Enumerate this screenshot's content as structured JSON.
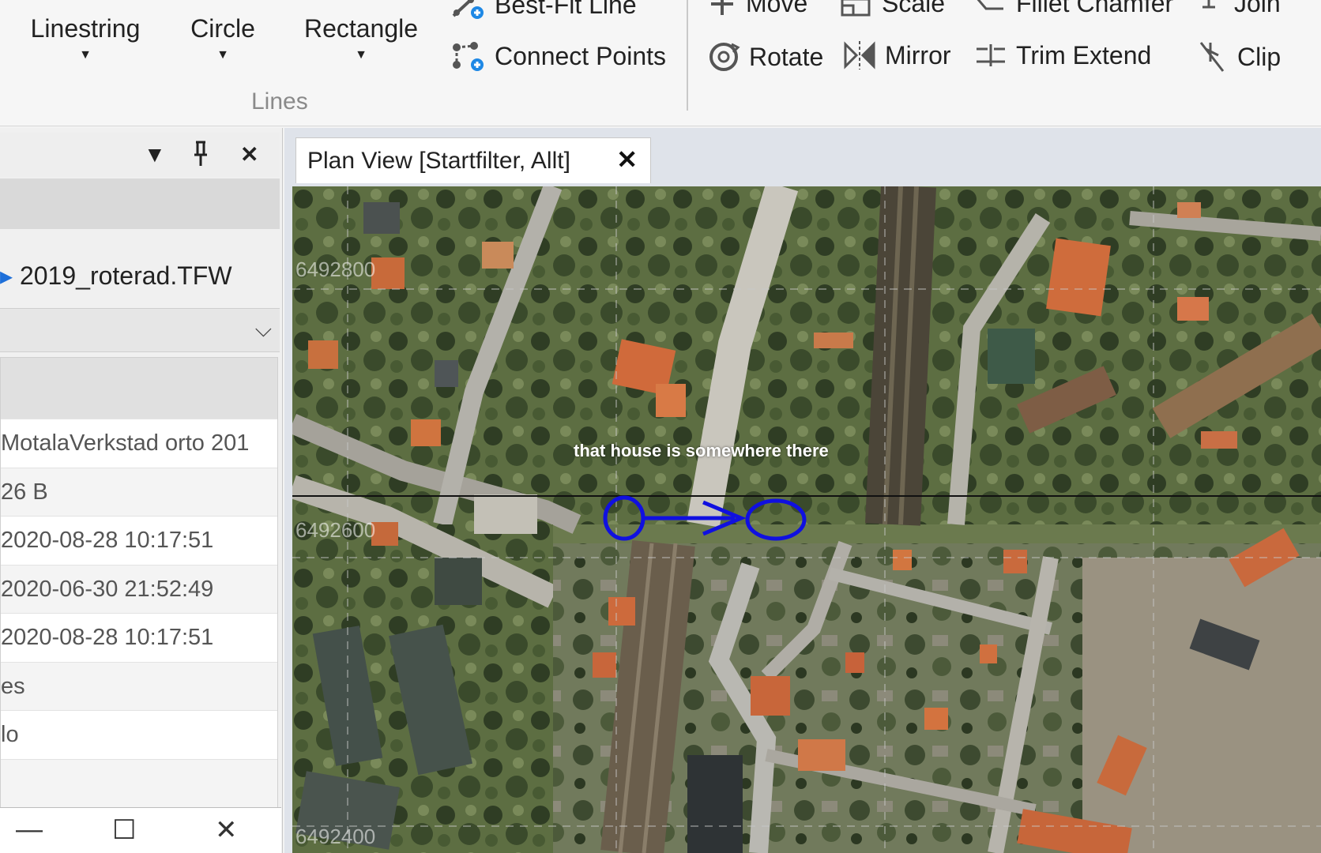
{
  "ribbon": {
    "linestring": "Linestring",
    "circle": "Circle",
    "rectangle": "Rectangle",
    "best_fit_line": "Best-Fit Line",
    "connect_points": "Connect Points",
    "lines_group": "Lines",
    "move": "Move",
    "scale": "Scale",
    "fillet_chamfer": "Fillet Chamfer",
    "join": "Join",
    "rotate": "Rotate",
    "mirror": "Mirror",
    "trim_extend": "Trim Extend",
    "clip": "Clip"
  },
  "left_panel": {
    "filename": "2019_roterad.TFW",
    "properties": [
      "MotalaVerkstad orto 201",
      "26 B",
      "2020-08-28 10:17:51",
      "2020-06-30 21:52:49",
      "2020-08-28 10:17:51",
      "es",
      "lo",
      ""
    ]
  },
  "document": {
    "tab_title": "Plan View [Startfilter, Allt]",
    "annotation": "that house is somewhere there",
    "coord_top": "6492800",
    "coord_mid": "6492600",
    "coord_bottom": "6492400"
  },
  "colors": {
    "annotation_marker": "#1010e0",
    "ribbon_bg": "#f6f6f6",
    "tab_bg": "#ffffff"
  }
}
